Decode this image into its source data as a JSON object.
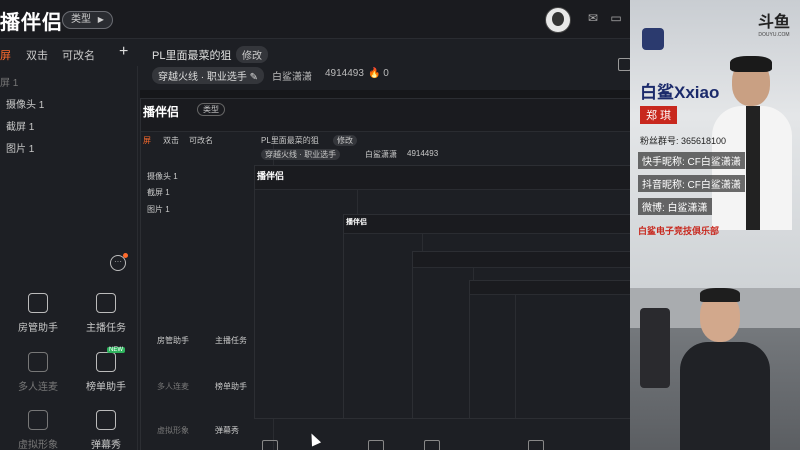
{
  "app": {
    "logo": "播伴侣",
    "type_pill": "类型",
    "tabs": [
      "屏",
      "双击",
      "可改名"
    ],
    "tab_add": "+"
  },
  "sidebar": {
    "items": [
      "屏 1",
      "摄像头 1",
      "截屏 1",
      "图片 1"
    ]
  },
  "tools": [
    {
      "label": "房管助手",
      "icon": "admin-helper-icon",
      "enabled": true
    },
    {
      "label": "主播任务",
      "icon": "task-check-icon",
      "enabled": true
    },
    {
      "label": "多人连麦",
      "icon": "multi-mic-icon",
      "enabled": false
    },
    {
      "label": "榜单助手",
      "icon": "ranking-star-icon",
      "enabled": true,
      "badge": "NEW"
    },
    {
      "label": "虚拟形象",
      "icon": "avatar-download-icon",
      "enabled": false
    },
    {
      "label": "弹幕秀",
      "icon": "danmaku-tv-icon",
      "enabled": true
    }
  ],
  "room": {
    "title": "PL里面最菜的狙",
    "edit": "修改",
    "category": "穿越火线 · 职业选手",
    "streamer": "白鲨潇潇",
    "room_id": "4914493",
    "heat": "0"
  },
  "nested": {
    "logo": "播伴侣",
    "type_pill": "类型",
    "tabs": [
      "屏",
      "双击",
      "可改名"
    ],
    "items": [
      "摄像头 1",
      "截屏 1",
      "图片 1"
    ],
    "tools": [
      "房管助手",
      "主播任务",
      "多人连麦",
      "榜单助手",
      "虚拟形象",
      "弹幕秀"
    ],
    "room_title": "PL里面最菜的狙",
    "edit": "修改",
    "category": "穿越火线 · 职业选手",
    "streamer": "白鲨潇潇",
    "room_id": "4914493"
  },
  "camera": {
    "platform": "斗鱼",
    "platform_sub": "DOUYU.COM",
    "name": "白鲨Xxiao",
    "real_name": "郑 琪",
    "fans": "粉丝群号: 365618100",
    "kuaishou": "快手昵称: CF白鲨潇潇",
    "douyin": "抖音昵称: CF白鲨潇潇",
    "weibo": "微博: 白鲨潇潇",
    "club": "白鲨电子竞技俱乐部"
  },
  "colors": {
    "accent": "#ff6b2c",
    "panel": "#1d1f24",
    "topbar": "#1a1b1f",
    "new_badge": "#2fb35e",
    "name_blue": "#1b2a6b",
    "name_red": "#c8281e"
  }
}
